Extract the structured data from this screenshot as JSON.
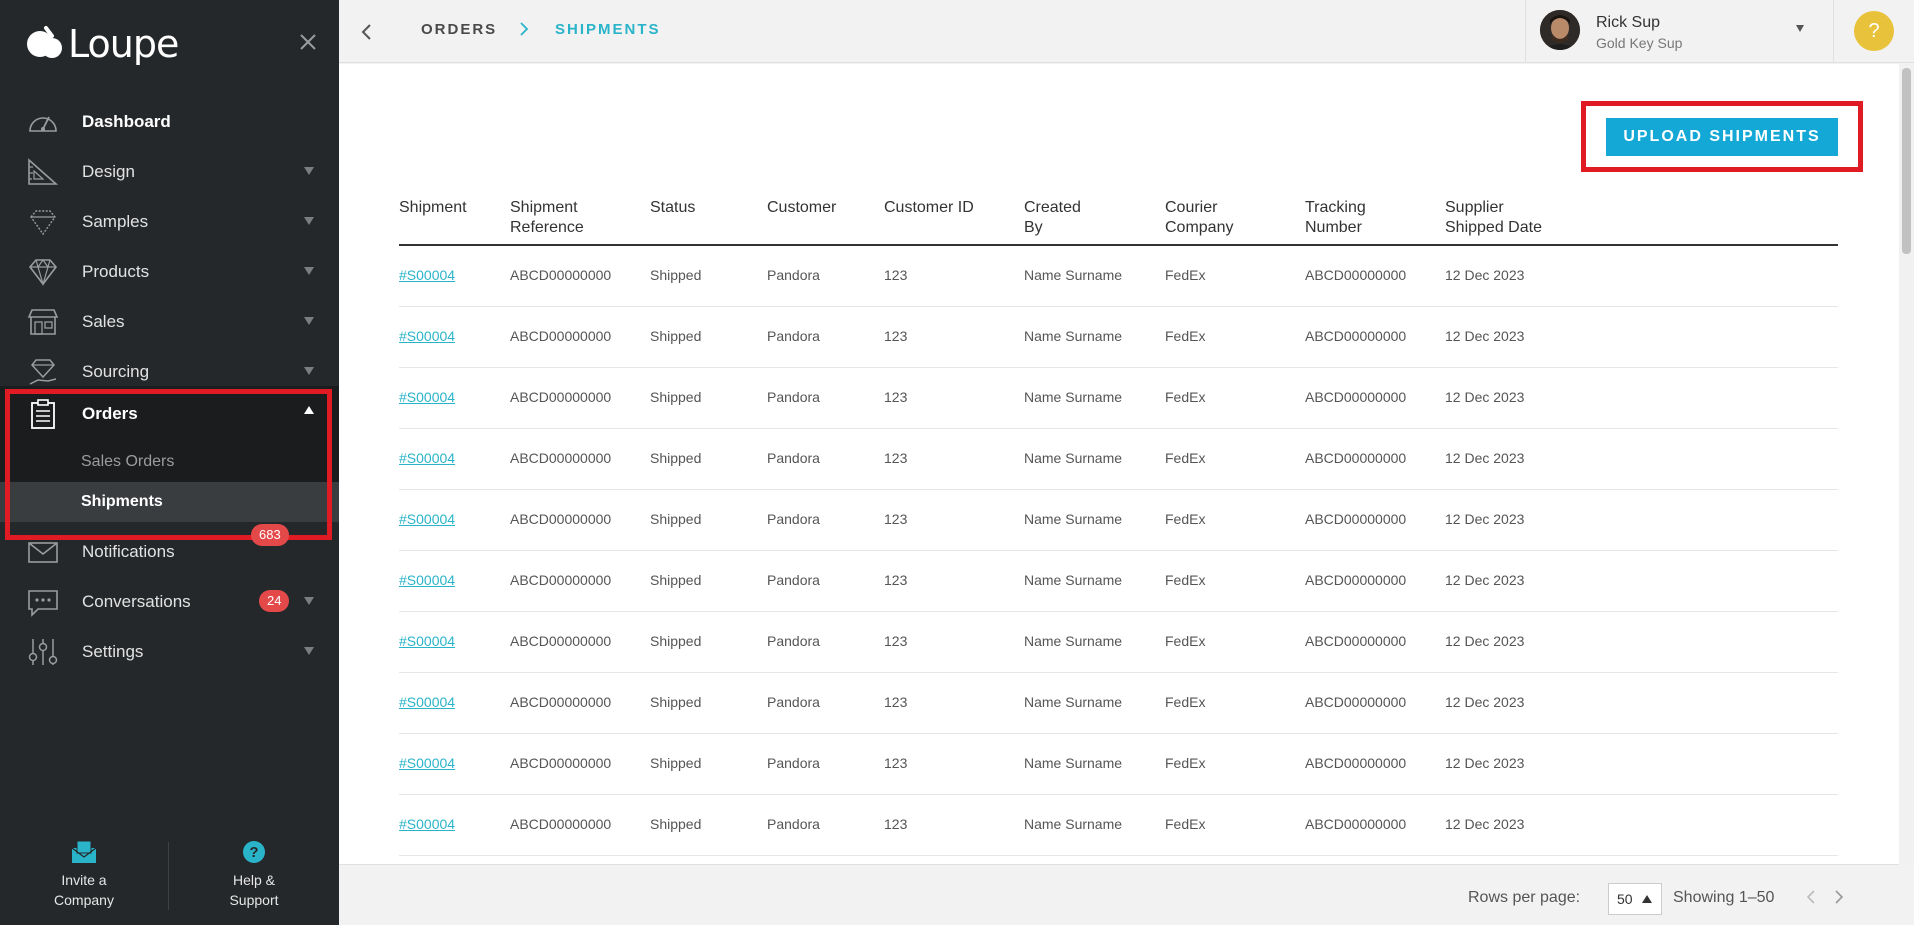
{
  "app": {
    "logo_text": "Loupe"
  },
  "sidebar": {
    "items": [
      {
        "label": "Dashboard",
        "icon": "speedometer-icon",
        "caret": false
      },
      {
        "label": "Design",
        "icon": "ruler-triangle-icon",
        "caret": true
      },
      {
        "label": "Samples",
        "icon": "diamond-outline-icon",
        "caret": true
      },
      {
        "label": "Products",
        "icon": "diamond-icon",
        "caret": true
      },
      {
        "label": "Sales",
        "icon": "storefront-icon",
        "caret": true
      },
      {
        "label": "Sourcing",
        "icon": "diamond-hand-icon",
        "caret": true
      }
    ],
    "orders": {
      "label": "Orders",
      "icon": "clipboard-icon",
      "sub_items": [
        {
          "label": "Sales Orders"
        },
        {
          "label": "Shipments"
        }
      ]
    },
    "lower_items": [
      {
        "label": "Notifications",
        "icon": "envelope-icon",
        "badge": "683"
      },
      {
        "label": "Conversations",
        "icon": "chat-icon",
        "badge": "24"
      },
      {
        "label": "Settings",
        "icon": "sliders-icon"
      }
    ],
    "bottom": {
      "invite_line1": "Invite a",
      "invite_line2": "Company",
      "help_line1": "Help &",
      "help_line2": "Support"
    }
  },
  "header": {
    "breadcrumb_parent": "ORDERS",
    "breadcrumb_current": "SHIPMENTS",
    "user_name": "Rick Sup",
    "user_role": "Gold Key Sup",
    "help_glyph": "?"
  },
  "main": {
    "upload_label": "UPLOAD SHIPMENTS",
    "columns": [
      {
        "line1": "Shipment",
        "line2": ""
      },
      {
        "line1": "Shipment",
        "line2": "Reference"
      },
      {
        "line1": "Status",
        "line2": ""
      },
      {
        "line1": "Customer",
        "line2": ""
      },
      {
        "line1": "Customer ID",
        "line2": ""
      },
      {
        "line1": "Created",
        "line2": "By"
      },
      {
        "line1": "Courier",
        "line2": "Company"
      },
      {
        "line1": "Tracking",
        "line2": "Number"
      },
      {
        "line1": "Supplier",
        "line2": "Shipped Date"
      }
    ],
    "rows": [
      [
        "#S00004",
        "ABCD00000000",
        "Shipped",
        "Pandora",
        "123",
        "Name Surname",
        "FedEx",
        "ABCD00000000",
        "12 Dec 2023"
      ],
      [
        "#S00004",
        "ABCD00000000",
        "Shipped",
        "Pandora",
        "123",
        "Name Surname",
        "FedEx",
        "ABCD00000000",
        "12 Dec 2023"
      ],
      [
        "#S00004",
        "ABCD00000000",
        "Shipped",
        "Pandora",
        "123",
        "Name Surname",
        "FedEx",
        "ABCD00000000",
        "12 Dec 2023"
      ],
      [
        "#S00004",
        "ABCD00000000",
        "Shipped",
        "Pandora",
        "123",
        "Name Surname",
        "FedEx",
        "ABCD00000000",
        "12 Dec 2023"
      ],
      [
        "#S00004",
        "ABCD00000000",
        "Shipped",
        "Pandora",
        "123",
        "Name Surname",
        "FedEx",
        "ABCD00000000",
        "12 Dec 2023"
      ],
      [
        "#S00004",
        "ABCD00000000",
        "Shipped",
        "Pandora",
        "123",
        "Name Surname",
        "FedEx",
        "ABCD00000000",
        "12 Dec 2023"
      ],
      [
        "#S00004",
        "ABCD00000000",
        "Shipped",
        "Pandora",
        "123",
        "Name Surname",
        "FedEx",
        "ABCD00000000",
        "12 Dec 2023"
      ],
      [
        "#S00004",
        "ABCD00000000",
        "Shipped",
        "Pandora",
        "123",
        "Name Surname",
        "FedEx",
        "ABCD00000000",
        "12 Dec 2023"
      ],
      [
        "#S00004",
        "ABCD00000000",
        "Shipped",
        "Pandora",
        "123",
        "Name Surname",
        "FedEx",
        "ABCD00000000",
        "12 Dec 2023"
      ],
      [
        "#S00004",
        "ABCD00000000",
        "Shipped",
        "Pandora",
        "123",
        "Name Surname",
        "FedEx",
        "ABCD00000000",
        "12 Dec 2023"
      ]
    ]
  },
  "footer": {
    "rows_per_page_label": "Rows per page:",
    "rows_per_page_value": "50",
    "showing": "Showing 1–50"
  },
  "colors": {
    "sidebar_bg": "#25282a",
    "accent_teal": "#2ab4c9",
    "button_blue": "#13a8d6",
    "badge_red": "#e4494a",
    "highlight_red": "#e01b24",
    "help_yellow": "#e8c23a"
  }
}
